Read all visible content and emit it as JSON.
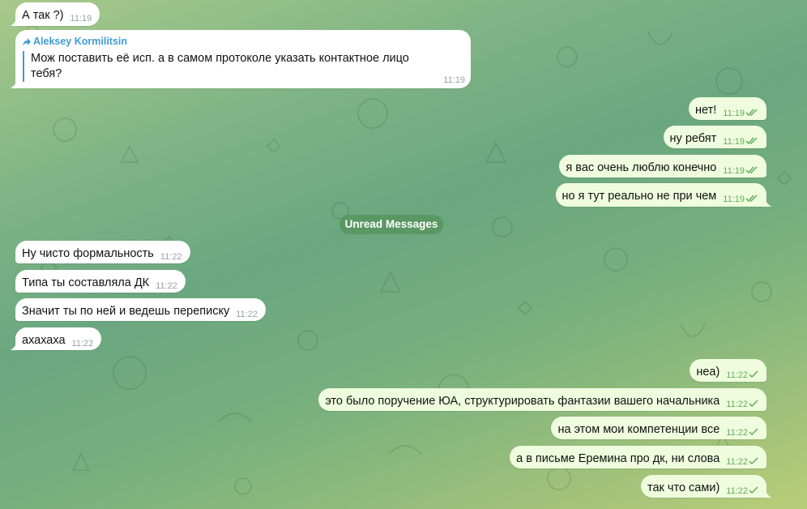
{
  "chat": {
    "incoming_top": [
      {
        "text": "А так ?)",
        "time": "11:19"
      }
    ],
    "forwarded": {
      "author": "Aleksey Kormilitsin",
      "text": "Мож поставить её исп. а в самом протоколе указать контактное лицо тебя?",
      "time": "11:19"
    },
    "outgoing_1": [
      {
        "text": "нет!",
        "time": "11:19"
      },
      {
        "text": "ну ребят",
        "time": "11:19"
      },
      {
        "text": "я вас очень люблю конечно",
        "time": "11:19"
      },
      {
        "text": "но я тут реально не при чем",
        "time": "11:19"
      }
    ],
    "unread_label": "Unread Messages",
    "incoming_2": [
      {
        "text": "Ну чисто формальность",
        "time": "11:22"
      },
      {
        "text": "Типа ты составляла ДК",
        "time": "11:22"
      },
      {
        "text": "Значит ты по ней и ведешь переписку",
        "time": "11:22"
      },
      {
        "text": "ахахаха",
        "time": "11:22"
      }
    ],
    "outgoing_2": [
      {
        "text": "неа)",
        "time": "11:22"
      },
      {
        "text": "это было поручение ЮА, структурировать фантазии вашего начальника",
        "time": "11:22"
      },
      {
        "text": "на этом мои компетенции все",
        "time": "11:22"
      },
      {
        "text": "а в письме Еремина про дк, ни слова",
        "time": "11:22"
      },
      {
        "text": "так что сами)",
        "time": "11:22"
      }
    ]
  },
  "colors": {
    "outgoing_bubble": "#effdde",
    "incoming_bubble": "#ffffff",
    "accent": "#3f9bd6",
    "check_color": "#5fae58",
    "unread_badge": "#56945e"
  }
}
